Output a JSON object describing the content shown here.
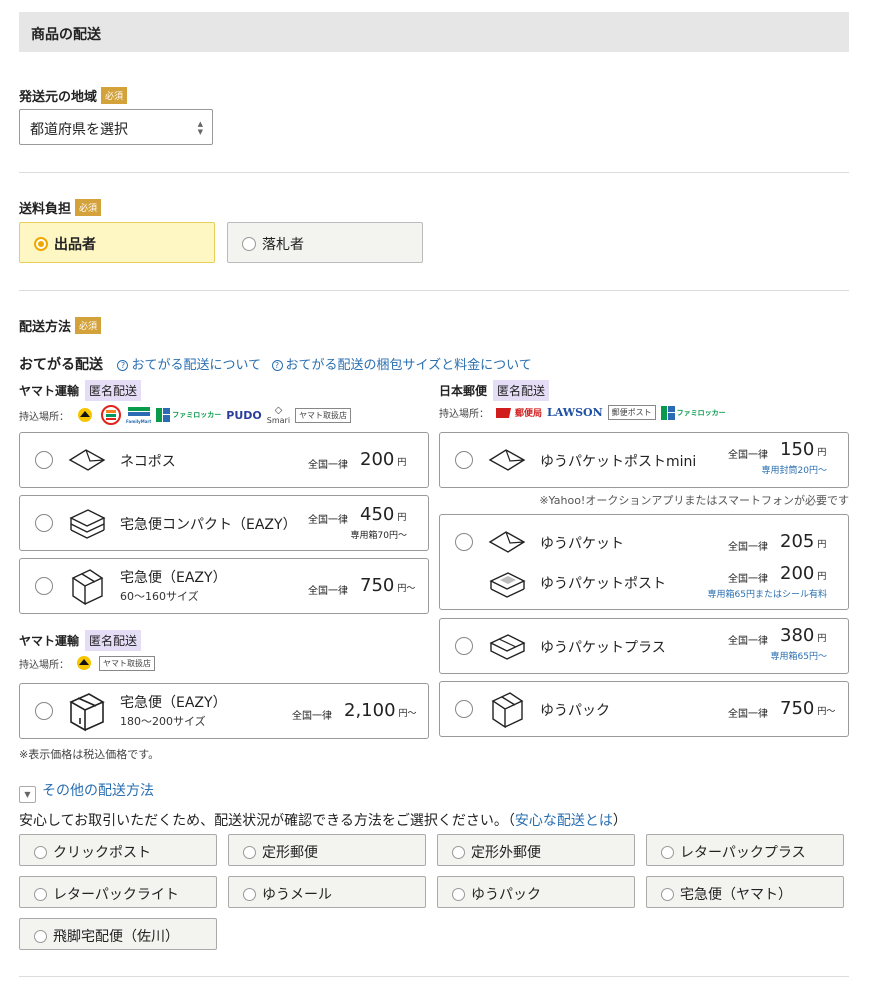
{
  "section": {
    "title": "商品の配送"
  },
  "origin": {
    "label": "発送元の地域",
    "required": "必須",
    "select_value": "都道府県を選択"
  },
  "payer": {
    "label": "送料負担",
    "required": "必須",
    "options": [
      "出品者",
      "落札者"
    ],
    "selected": "出品者"
  },
  "method": {
    "label": "配送方法",
    "required": "必須",
    "otegaru": {
      "title": "おてがる配送",
      "link1": "おてがる配送について",
      "link2": "おてがる配送の梱包サイズと料金について"
    },
    "yamato": {
      "carrier": "ヤマト運輸",
      "anon": "匿名配送",
      "mochi_label": "持込場所：",
      "logos": [
        "FamilyMart",
        "ファミロッカー",
        "PUDO",
        "Smari"
      ],
      "tag": "ヤマト取扱店",
      "options": [
        {
          "name": "ネコポス",
          "uniform": "全国一律",
          "price": "200",
          "unit": "円",
          "note": ""
        },
        {
          "name": "宅急便コンパクト（EAZY）",
          "uniform": "全国一律",
          "price": "450",
          "unit": "円",
          "note": "専用箱70円〜"
        },
        {
          "name": "宅急便（EAZY）",
          "sub": "60〜160サイズ",
          "uniform": "全国一律",
          "price": "750",
          "unit": "円〜",
          "note": ""
        }
      ]
    },
    "yamato2": {
      "carrier": "ヤマト運輸",
      "anon": "匿名配送",
      "mochi_label": "持込場所：",
      "tag": "ヤマト取扱店",
      "options": [
        {
          "name": "宅急便（EAZY）",
          "sub": "180〜200サイズ",
          "uniform": "全国一律",
          "price": "2,100",
          "unit": "円〜"
        }
      ]
    },
    "japanpost": {
      "carrier": "日本郵便",
      "anon": "匿名配送",
      "mochi_label": "持込場所：",
      "logos": [
        "郵便局",
        "LAWSON",
        "ファミロッカー"
      ],
      "tag": "郵便ポスト",
      "note_app": "※Yahoo!オークションアプリまたはスマートフォンが必要です",
      "options": [
        {
          "name": "ゆうパケットポストmini",
          "uniform": "全国一律",
          "price": "150",
          "unit": "円",
          "note": "専用封筒20円〜"
        },
        {
          "name": "ゆうパケット",
          "uniform": "全国一律",
          "price": "205",
          "unit": "円"
        },
        {
          "name": "ゆうパケットポスト",
          "uniform": "全国一律",
          "price": "200",
          "unit": "円",
          "note": "専用箱65円またはシール有料"
        },
        {
          "name": "ゆうパケットプラス",
          "uniform": "全国一律",
          "price": "380",
          "unit": "円",
          "note": "専用箱65円〜"
        },
        {
          "name": "ゆうパック",
          "uniform": "全国一律",
          "price": "750",
          "unit": "円〜"
        }
      ]
    },
    "tax_note": "※表示価格は税込価格です。"
  },
  "other": {
    "toggle": "その他の配送方法",
    "notice_pre": "安心してお取引いただくため、配送状況が確認できる方法をご選択ください。（",
    "notice_link": "安心な配送とは",
    "notice_post": "）",
    "options": [
      "クリックポスト",
      "定形郵便",
      "定形外郵便",
      "レターパックプラス",
      "レターパックライト",
      "ゆうメール",
      "ゆうパック",
      "宅急便（ヤマト）",
      "飛脚宅配便（佐川）"
    ]
  }
}
